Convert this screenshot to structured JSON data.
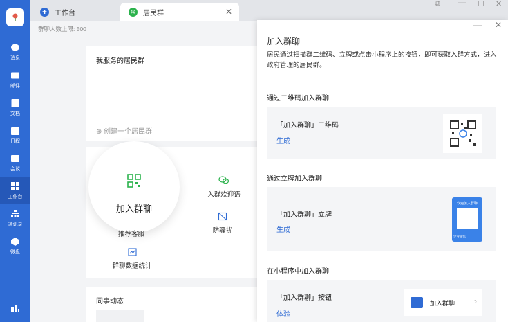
{
  "rail": {
    "items": [
      {
        "label": "消息",
        "icon": "chat-icon"
      },
      {
        "label": "邮件",
        "icon": "mail-icon"
      },
      {
        "label": "文档",
        "icon": "doc-icon"
      },
      {
        "label": "日程",
        "icon": "calendar-icon"
      },
      {
        "label": "会议",
        "icon": "meeting-icon"
      },
      {
        "label": "工作台",
        "icon": "workbench-icon"
      },
      {
        "label": "通讯录",
        "icon": "contacts-icon"
      },
      {
        "label": "微盘",
        "icon": "drive-icon"
      }
    ]
  },
  "tabs": [
    {
      "label": "工作台"
    },
    {
      "label": "居民群"
    }
  ],
  "main": {
    "subtitle": "群聊人数上限: 500",
    "my_groups_title": "我服务的居民群",
    "create_label": "⊕ 创建一个居民群",
    "join_label": "加入群聊",
    "features": {
      "welcome": "入群欢迎语",
      "recommend": "推荐客服",
      "anti_harass": "防骚扰",
      "stats": "群聊数据统计"
    },
    "colleague_title": "同事动态"
  },
  "panel": {
    "title": "加入群聊",
    "description": "居民通过扫描群二维码、立牌或点击小程序上的按钮，即可获取入群方式，进入政府管理的居民群。",
    "sections": [
      {
        "heading": "通过二维码加入群聊",
        "item": "「加入群聊」二维码",
        "action": "生成"
      },
      {
        "heading": "通过立牌加入群聊",
        "item": "「加入群聊」立牌",
        "action": "生成",
        "standee_title": "欢迎加入群聊",
        "standee_brand": "企业微信"
      },
      {
        "heading": "在小程序中加入群聊",
        "item": "「加入群聊」按钮",
        "action": "体验",
        "button_label": "加入群聊"
      }
    ]
  },
  "colors": {
    "accent": "#2f6bd4",
    "green": "#2bb24c"
  }
}
